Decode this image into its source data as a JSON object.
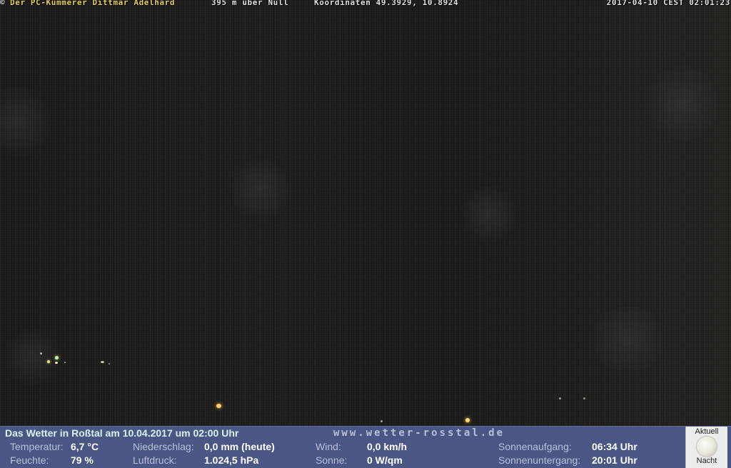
{
  "caption": {
    "copyright_symbol": "©",
    "owner": "Der PC-Kümmerer Dittmar Adelhard",
    "altitude": "395 m über Null",
    "coordinates": "Koordinaten 49.3929, 10.8924",
    "datetime": "2017-04-10 CEST 02:01:23"
  },
  "weather": {
    "title": "Das Wetter in Roßtal am 10.04.2017 um 02:00 Uhr",
    "site": "www.wetter-rosstal.de",
    "temperature_label": "Temperatur:",
    "temperature_value": "6,7 °C",
    "humidity_label": "Feuchte:",
    "humidity_value": "79 %",
    "precipitation_label": "Niederschlag:",
    "precipitation_value": "0,0 mm (heute)",
    "pressure_label": "Luftdruck:",
    "pressure_value": "1.024,5 hPa",
    "wind_label": "Wind:",
    "wind_value": "0,0 km/h",
    "sun_label": "Sonne:",
    "sun_value": "0 W/qm",
    "sunrise_label": "Sonnenaufgang:",
    "sunrise_value": "06:34 Uhr",
    "sunset_label": "Sonnenuntergang:",
    "sunset_value": "20:01 Uhr"
  },
  "moon": {
    "top_label": "Aktuell",
    "bottom_label": "Nacht",
    "icon": "moon-icon"
  },
  "colors": {
    "bar_background": "#4a5684",
    "owner_text": "#e9d34a",
    "title_text": "#d7f2f2"
  }
}
